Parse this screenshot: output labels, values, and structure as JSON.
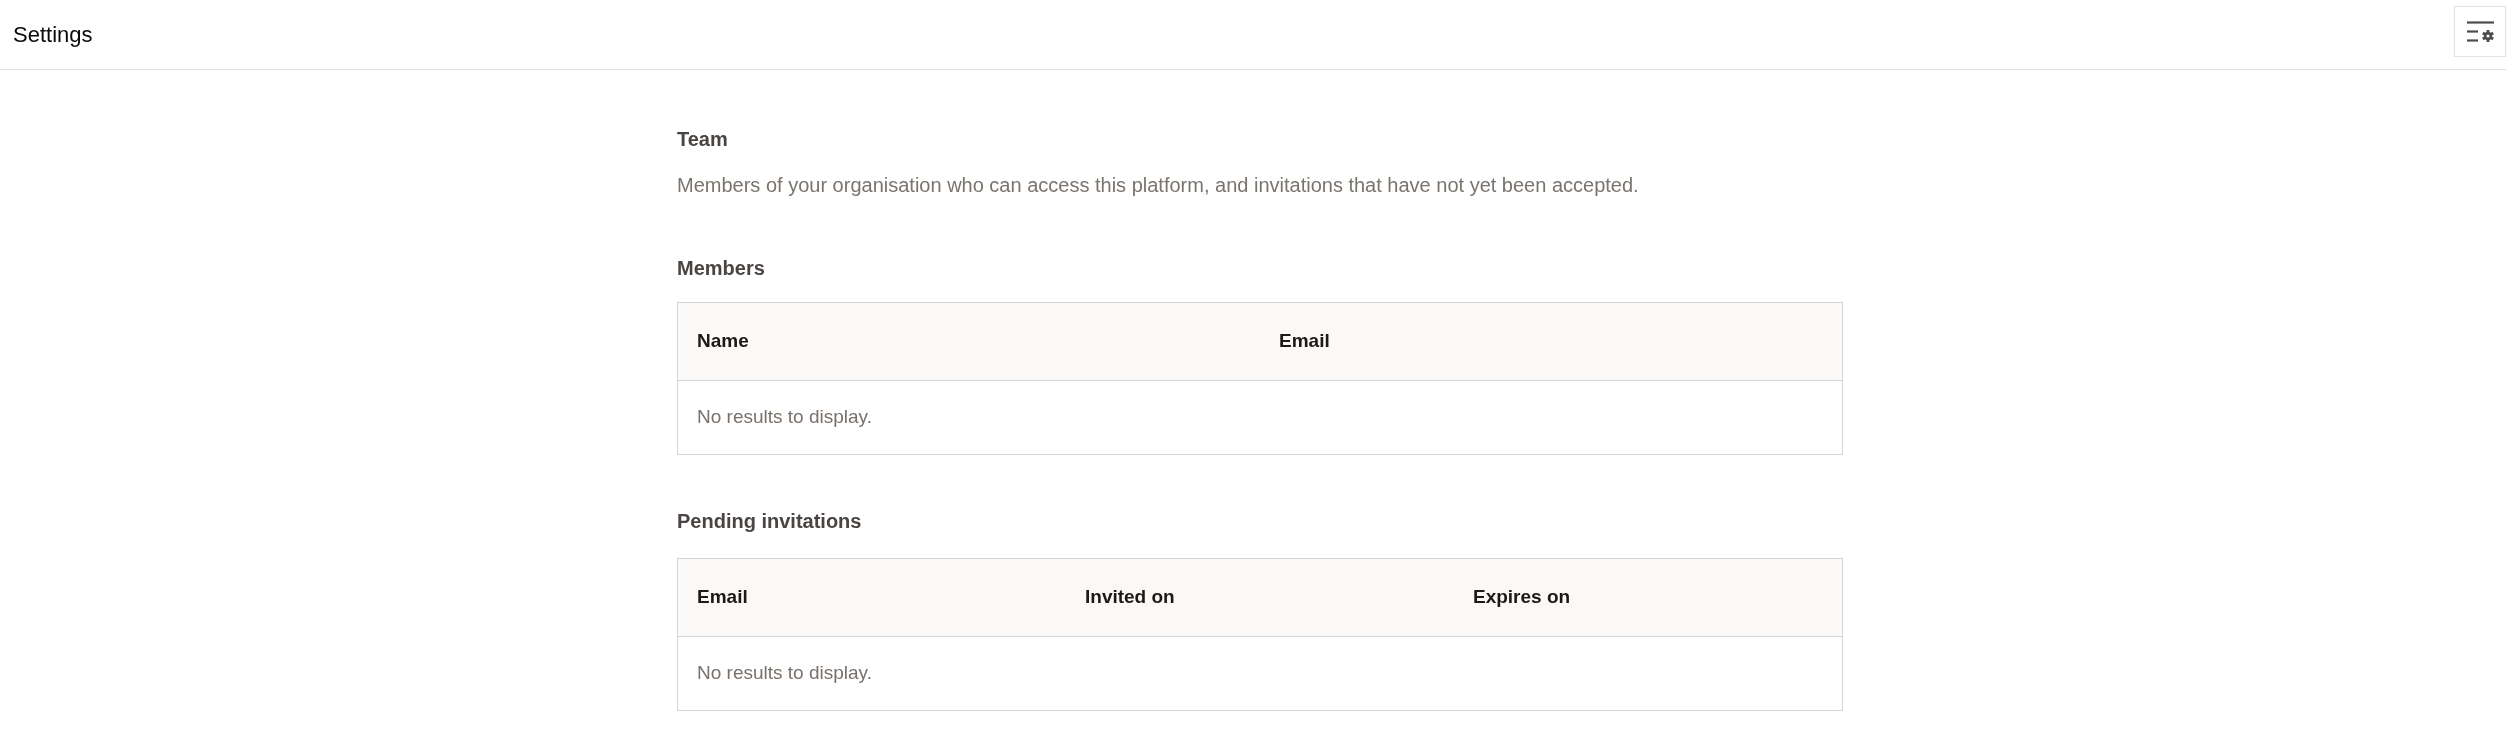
{
  "header": {
    "title": "Settings"
  },
  "section": {
    "title": "Team",
    "description": "Members of your organisation who can access this platform, and invitations that have not yet been accepted."
  },
  "tables": [
    {
      "title": "Members",
      "columns": [
        "Name",
        "Email"
      ],
      "empty_message": "No results to display."
    },
    {
      "title": "Pending invitations",
      "columns": [
        "Email",
        "Invited on",
        "Expires on"
      ],
      "empty_message": "No results to display."
    }
  ]
}
